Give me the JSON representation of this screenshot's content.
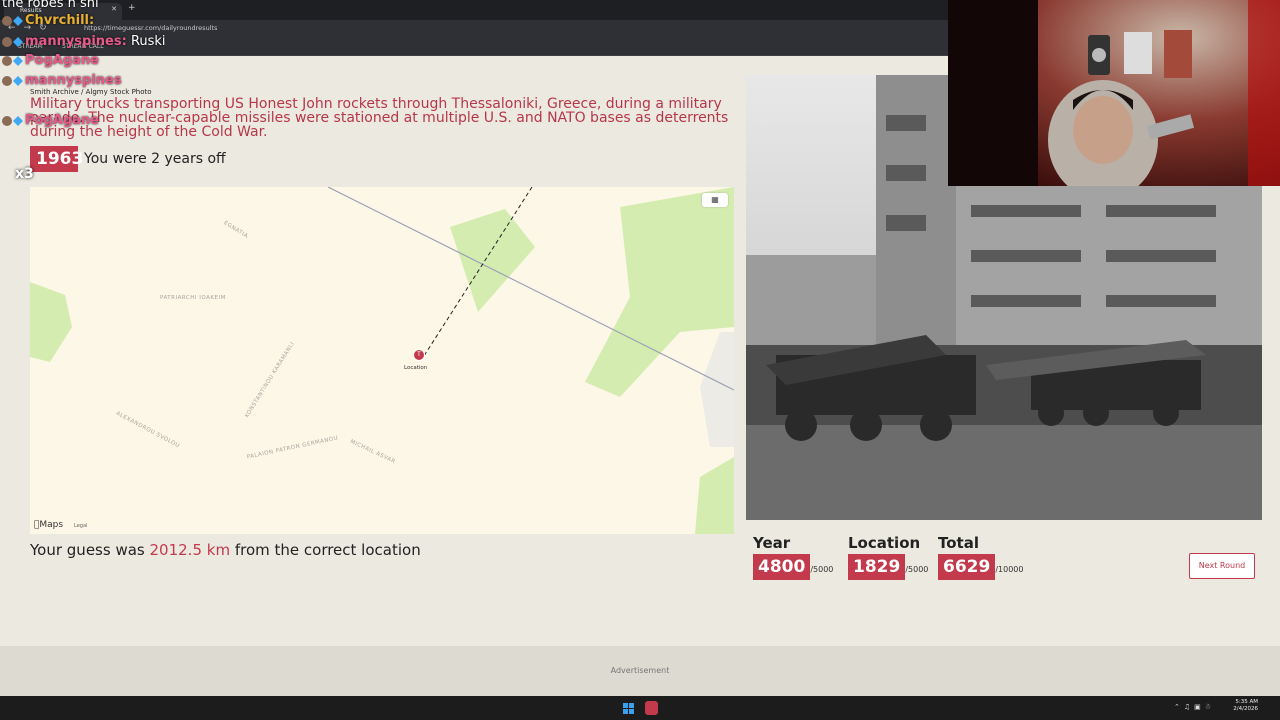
{
  "browser": {
    "tab_title": "Results",
    "url": "https://timeguessr.com/dailyroundresults",
    "bookmarks": [
      "STREAM",
      "STREAM CALL"
    ]
  },
  "round": {
    "credit": "Smith Archive / Algmy Stock Photo",
    "description": "Military trucks transporting US Honest John rockets through Thessaloniki, Greece, during a military parade. The nuclear-capable missiles were stationed at multiple U.S. and NATO bases as deterrents during the height of the Cold War.",
    "year": "1963",
    "year_feedback": "You were 2 years off",
    "guess_prefix": "Your guess was ",
    "guess_distance": "2012.5 km",
    "guess_suffix": " from the correct location"
  },
  "map": {
    "pin_label": "Location",
    "pin_glyph": "T",
    "attribution": "Maps",
    "legal": "Legal",
    "streets": [
      "EGNATIA",
      "PATRIARCHI IOAKEIM",
      "ALEXANDROU SVOLOU",
      "PALAION PATRON GERMANOU",
      "KONSTANTINOU KARAMANLI",
      "MICHAIL ASVAR"
    ]
  },
  "scores": {
    "year": {
      "label": "Year",
      "value": "4800",
      "max": "/5000"
    },
    "location": {
      "label": "Location",
      "value": "1829",
      "max": "/5000"
    },
    "total": {
      "label": "Total",
      "value": "6629",
      "max": "/10000"
    }
  },
  "next_button": "Next Round",
  "advertisement": "Advertisement",
  "chat": [
    {
      "user": "",
      "text": "the robes n shi"
    },
    {
      "user": "Chvrchill:",
      "text": ""
    },
    {
      "user": "mannyspines:",
      "text": " Ruski"
    },
    {
      "user": "PogAgane",
      "text": ""
    },
    {
      "user": "mannyspines",
      "text": ""
    },
    {
      "user": "PogAgane",
      "text": ""
    }
  ],
  "chat_multiplier": "x3",
  "clock": {
    "time": "5:35 AM",
    "date": "2/4/2026"
  },
  "colors": {
    "accent": "#c23a4c",
    "page_bg": "#eceae0",
    "map_bg": "#fcf7e6",
    "park": "#d5ecb0"
  }
}
